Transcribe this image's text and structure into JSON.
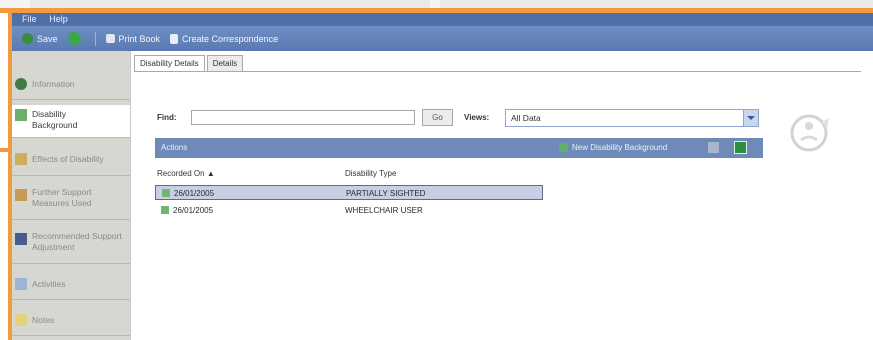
{
  "menu": [
    "File",
    "Help"
  ],
  "toolbar": {
    "save_label": "Save",
    "print_label": "Print Book",
    "create_corr_label": "Create Correspondence"
  },
  "sidebar": {
    "items": [
      {
        "label": "Information",
        "icon": "info-icon"
      },
      {
        "label": "Disability Background",
        "icon": "disability-icon",
        "active": true
      },
      {
        "label": "Effects of Disability",
        "icon": "effects-icon"
      },
      {
        "label": "Further Support Measures Used",
        "icon": "support-icon"
      },
      {
        "label": "Recommended Support Adjustment",
        "icon": "book-icon"
      },
      {
        "label": "Activities",
        "icon": "activities-icon"
      },
      {
        "label": "Notes",
        "icon": "notes-icon"
      }
    ]
  },
  "tabs": [
    "Disability Details",
    "Details"
  ],
  "filter": {
    "find_label": "Find:",
    "find_value": "",
    "go_label": "Go",
    "views_label": "Views:",
    "views_value": "All Data"
  },
  "actionbar": {
    "actions_label": "Actions",
    "new_label": "New Disability Background"
  },
  "grid": {
    "columns": [
      "Recorded On",
      "Disability Type"
    ],
    "rows": [
      {
        "recorded_on": "26/01/2005",
        "type": "PARTIALLY SIGHTED",
        "selected": true
      },
      {
        "recorded_on": "26/01/2005",
        "type": "WHEELCHAIR USER",
        "selected": false
      }
    ]
  },
  "colors": {
    "highlight": "#f39a3f",
    "toolbar": "#5a79b2",
    "actionbar": "#6d8ab9",
    "selected_row": "#c9cfe3"
  }
}
